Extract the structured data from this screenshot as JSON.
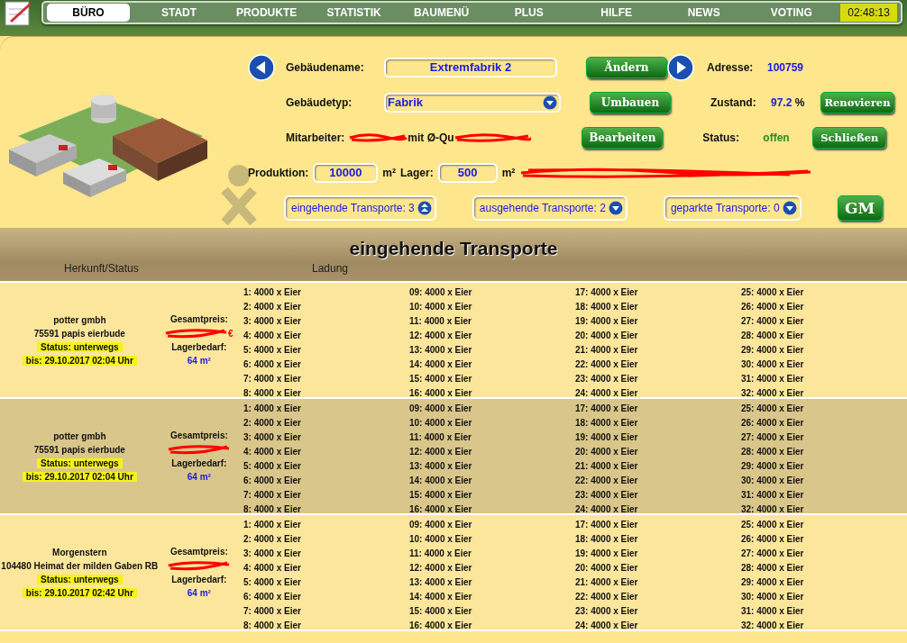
{
  "nav": {
    "tabs": [
      {
        "label": "BÜRO",
        "selected": true
      },
      {
        "label": "STADT",
        "selected": false
      },
      {
        "label": "PRODUKTE",
        "selected": false
      },
      {
        "label": "STATISTIK",
        "selected": false
      },
      {
        "label": "BAUMENÜ",
        "selected": false
      },
      {
        "label": "PLUS",
        "selected": false
      },
      {
        "label": "HILFE",
        "selected": false
      },
      {
        "label": "NEWS",
        "selected": false
      },
      {
        "label": "VOTING",
        "selected": false
      }
    ],
    "clock": "02:48:13"
  },
  "building": {
    "name_label": "Gebäudename:",
    "name": "Extremfabrik 2",
    "rename_button": "Ändern",
    "type_label": "Gebäudetyp:",
    "type": "Fabrik",
    "rebuild_button": "Umbauen",
    "staff_label": "Mitarbeiter:",
    "staff_visible": "mit Ø-Qu",
    "edit_button": "Bearbeiten",
    "address_label": "Adresse:",
    "address": "100759",
    "condition_label": "Zustand:",
    "condition": "97.2",
    "condition_unit": "%",
    "renovate_button": "Renovieren",
    "status_label": "Status:",
    "status": "offen",
    "close_button": "Schließen",
    "production_label": "Produktion:",
    "production": "10000",
    "production_unit": "m²",
    "storage_label": "Lager:",
    "storage": "500",
    "storage_unit": "m²",
    "transport_toggles": [
      {
        "label": "eingehende Transporte: 3",
        "expanded": true
      },
      {
        "label": "ausgehende Transporte: 2",
        "expanded": false
      },
      {
        "label": "geparkte Transporte: 0",
        "expanded": false
      }
    ],
    "gm_button": "GM"
  },
  "section_title": "eingehende Transporte",
  "columns": [
    "Herkunft/Status",
    "Ladung"
  ],
  "transports": [
    {
      "company": "potter gmbh",
      "origin": "75591 papis eierbude",
      "status": "Status: unterwegs",
      "arrival": "bis: 29.10.2017 02:04 Uhr",
      "price_label": "Gesamtpreis:",
      "price_visible": "€",
      "storage_label": "Lagerbedarf:",
      "storage_need": "64 m²",
      "cargo": [
        "1: 4000 x Eier",
        "2: 4000 x Eier",
        "3: 4000 x Eier",
        "4: 4000 x Eier",
        "5: 4000 x Eier",
        "6: 4000 x Eier",
        "7: 4000 x Eier",
        "8: 4000 x Eier",
        "09: 4000 x Eier",
        "10: 4000 x Eier",
        "11: 4000 x Eier",
        "12: 4000 x Eier",
        "13: 4000 x Eier",
        "14: 4000 x Eier",
        "15: 4000 x Eier",
        "16: 4000 x Eier",
        "17: 4000 x Eier",
        "18: 4000 x Eier",
        "19: 4000 x Eier",
        "20: 4000 x Eier",
        "21: 4000 x Eier",
        "22: 4000 x Eier",
        "23: 4000 x Eier",
        "24: 4000 x Eier",
        "25: 4000 x Eier",
        "26: 4000 x Eier",
        "27: 4000 x Eier",
        "28: 4000 x Eier",
        "29: 4000 x Eier",
        "30: 4000 x Eier",
        "31: 4000 x Eier",
        "32: 4000 x Eier"
      ]
    },
    {
      "company": "potter gmbh",
      "origin": "75591 papis eierbude",
      "status": "Status: unterwegs",
      "arrival": "bis: 29.10.2017 02:04 Uhr",
      "price_label": "Gesamtpreis:",
      "storage_label": "Lagerbedarf:",
      "storage_need": "64 m²",
      "cargo": [
        "1: 4000 x Eier",
        "2: 4000 x Eier",
        "3: 4000 x Eier",
        "4: 4000 x Eier",
        "5: 4000 x Eier",
        "6: 4000 x Eier",
        "7: 4000 x Eier",
        "8: 4000 x Eier",
        "09: 4000 x Eier",
        "10: 4000 x Eier",
        "11: 4000 x Eier",
        "12: 4000 x Eier",
        "13: 4000 x Eier",
        "14: 4000 x Eier",
        "15: 4000 x Eier",
        "16: 4000 x Eier",
        "17: 4000 x Eier",
        "18: 4000 x Eier",
        "19: 4000 x Eier",
        "20: 4000 x Eier",
        "21: 4000 x Eier",
        "22: 4000 x Eier",
        "23: 4000 x Eier",
        "24: 4000 x Eier",
        "25: 4000 x Eier",
        "26: 4000 x Eier",
        "27: 4000 x Eier",
        "28: 4000 x Eier",
        "29: 4000 x Eier",
        "30: 4000 x Eier",
        "31: 4000 x Eier",
        "32: 4000 x Eier"
      ]
    },
    {
      "company": "Morgenstern",
      "origin": "104480 Heimat der milden Gaben RB",
      "status": "Status: unterwegs",
      "arrival": "bis: 29.10.2017 02:42 Uhr",
      "price_label": "Gesamtpreis:",
      "storage_label": "Lagerbedarf:",
      "storage_need": "64 m²",
      "cargo": [
        "1: 4000 x Eier",
        "2: 4000 x Eier",
        "3: 4000 x Eier",
        "4: 4000 x Eier",
        "5: 4000 x Eier",
        "6: 4000 x Eier",
        "7: 4000 x Eier",
        "8: 4000 x Eier",
        "09: 4000 x Eier",
        "10: 4000 x Eier",
        "11: 4000 x Eier",
        "12: 4000 x Eier",
        "13: 4000 x Eier",
        "14: 4000 x Eier",
        "15: 4000 x Eier",
        "16: 4000 x Eier",
        "17: 4000 x Eier",
        "18: 4000 x Eier",
        "19: 4000 x Eier",
        "20: 4000 x Eier",
        "21: 4000 x Eier",
        "22: 4000 x Eier",
        "23: 4000 x Eier",
        "24: 4000 x Eier",
        "25: 4000 x Eier",
        "26: 4000 x Eier",
        "27: 4000 x Eier",
        "28: 4000 x Eier",
        "29: 4000 x Eier",
        "30: 4000 x Eier",
        "31: 4000 x Eier",
        "32: 4000 x Eier"
      ]
    }
  ]
}
